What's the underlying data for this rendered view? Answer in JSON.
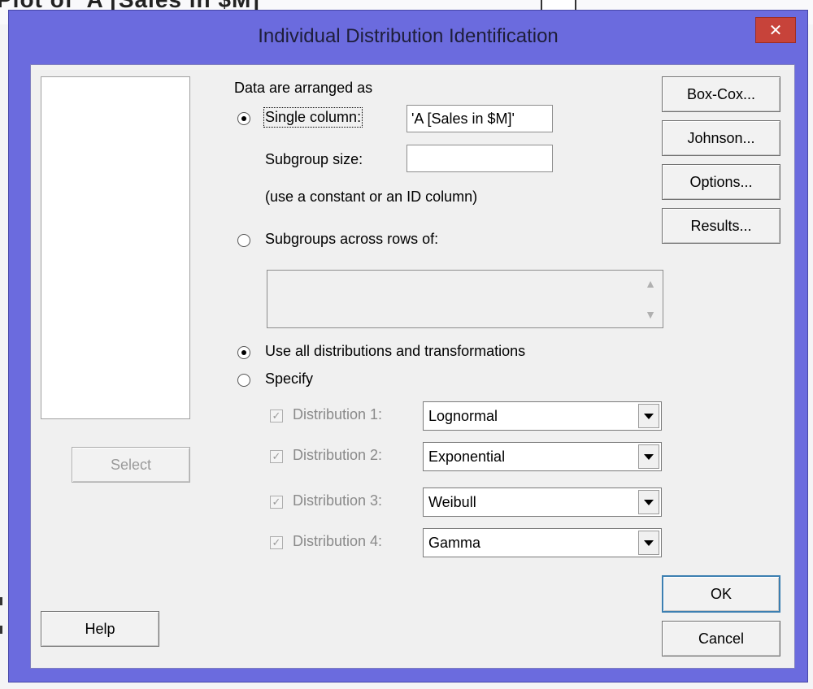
{
  "background": {
    "fragment_text": "Plot of 'A [Sales in $M]"
  },
  "dialog": {
    "title": "Individual Distribution Identification",
    "close_glyph": "✕",
    "select_button": "Select",
    "help_button": "Help",
    "arranged_label": "Data are arranged as",
    "single_column_label": "Single column:",
    "single_column_value": "'A [Sales in $M]'",
    "subgroup_size_label": "Subgroup size:",
    "subgroup_size_value": "",
    "constant_hint": "(use a constant or an ID column)",
    "subgroups_across_label": "Subgroups across rows of:",
    "use_all_label": "Use all distributions and transformations",
    "specify_label": "Specify",
    "distributions": [
      {
        "label": "Distribution 1:",
        "value": "Lognormal",
        "checked": true
      },
      {
        "label": "Distribution 2:",
        "value": "Exponential",
        "checked": true
      },
      {
        "label": "Distribution 3:",
        "value": "Weibull",
        "checked": true
      },
      {
        "label": "Distribution 4:",
        "value": "Gamma",
        "checked": true
      }
    ],
    "side_buttons": [
      "Box-Cox...",
      "Johnson...",
      "Options...",
      "Results..."
    ],
    "ok_button": "OK",
    "cancel_button": "Cancel"
  },
  "colors": {
    "frame": "#6b6bde",
    "close": "#c7433a",
    "client": "#f0f0f0"
  }
}
